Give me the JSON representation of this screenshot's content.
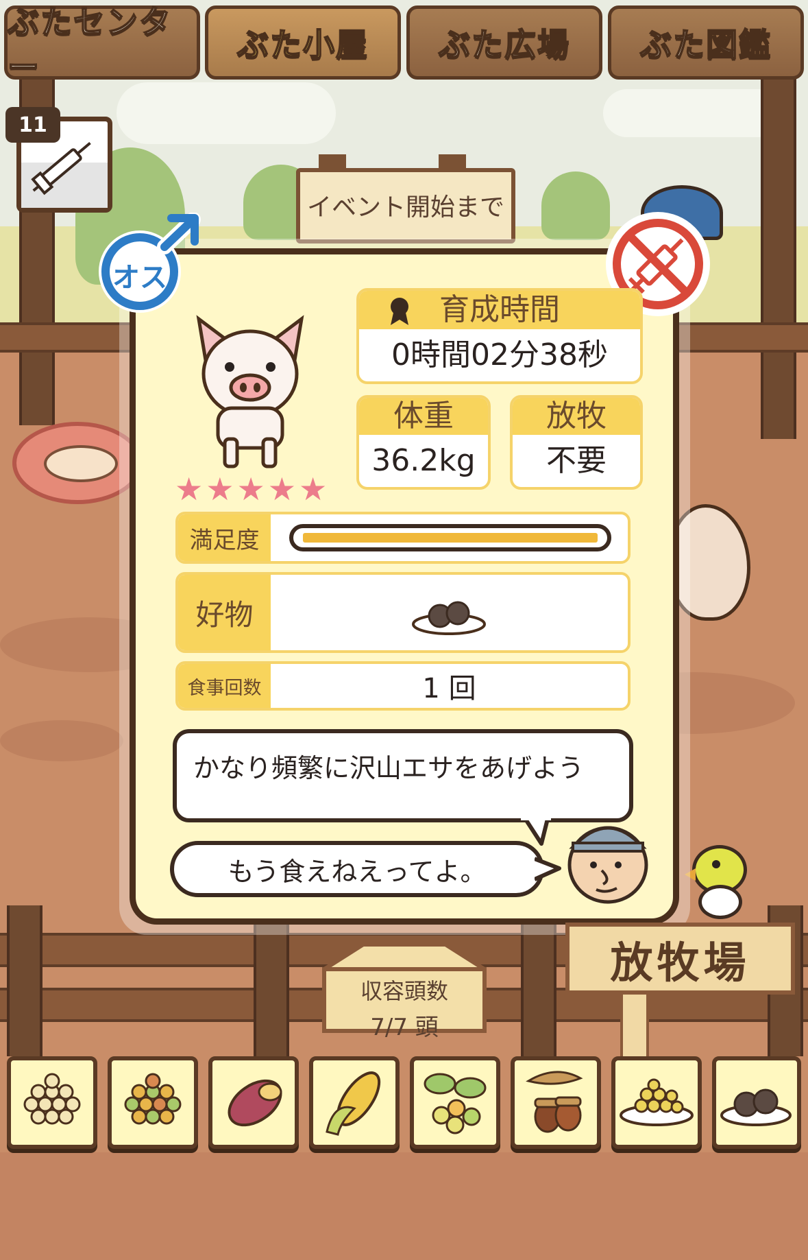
{
  "tabs": [
    {
      "label": "ぶたセンター",
      "active": false
    },
    {
      "label": "ぶた小屋",
      "active": true
    },
    {
      "label": "ぶた広場",
      "active": false
    },
    {
      "label": "ぶた図鑑",
      "active": false
    }
  ],
  "injection_count": "11",
  "event_sign": "イベント開始まで",
  "gender_label": "オス",
  "stats": {
    "training_time_label": "育成時間",
    "training_time_value": "0時間02分38秒",
    "weight_label": "体重",
    "weight_value": "36.2kg",
    "grazing_label": "放牧",
    "grazing_value": "不要"
  },
  "rating_stars": "★★★★★",
  "satisfaction_label": "満足度",
  "satisfaction_level": 1.0,
  "favorite_label": "好物",
  "favorite_food_icon": "meatball-plate-icon",
  "meal_count_label": "食事回数",
  "meal_count_value": "1 回",
  "advice_text": "かなり頻繁に沢山エサをあげよう",
  "pig_speech": "もう食えねえってよ。",
  "capacity": {
    "label": "収容頭数",
    "value": "7/7 頭"
  },
  "pasture_sign": "放牧場",
  "food_slots": [
    "beans-icon",
    "mixed-beans-icon",
    "sweet-potato-icon",
    "corn-icon",
    "berries-icon",
    "acorn-icon",
    "bean-plate-icon",
    "meatball-plate-icon"
  ],
  "colors": {
    "panel_bg": "#fff8c8",
    "accent_yellow": "#f8d45c",
    "wood_dark": "#4a2f1c",
    "star_pink": "#ec7c8b",
    "no_injection_red": "#d9493a",
    "male_blue": "#2d7cc6"
  }
}
